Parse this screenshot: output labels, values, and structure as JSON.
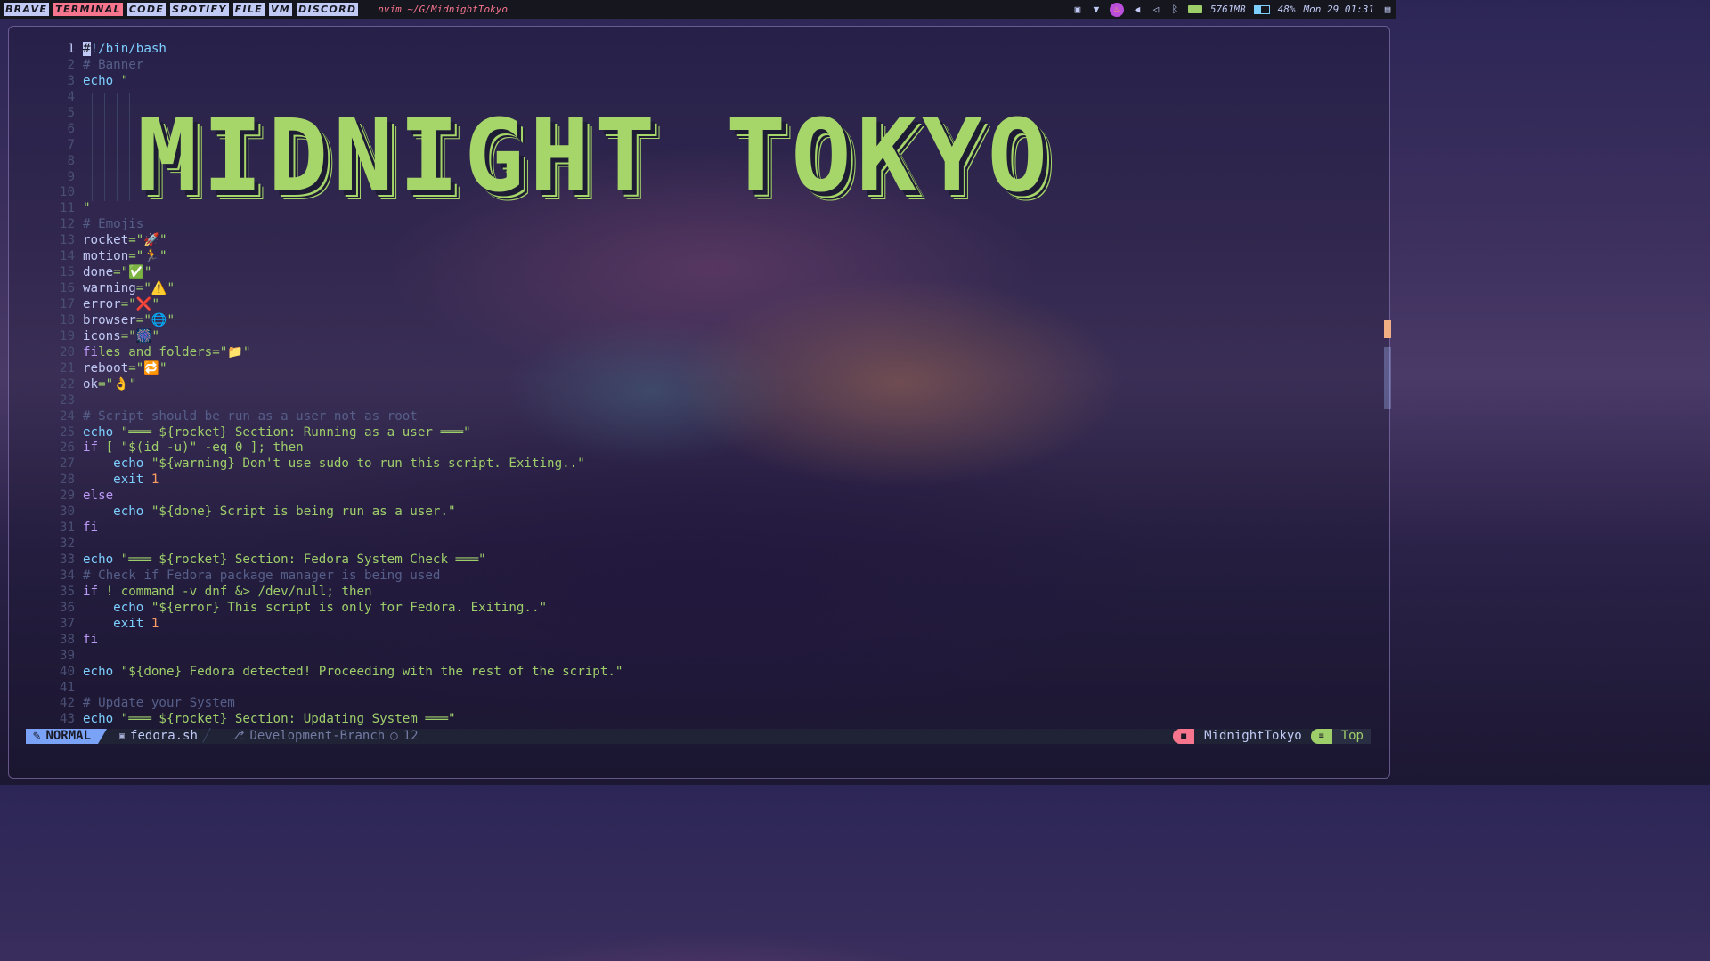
{
  "topbar": {
    "workspaces": [
      "BRAVE",
      "TERMINAL",
      "CODE",
      "SPOTIFY",
      "FILE",
      "VM",
      "DISCORD"
    ],
    "active_workspace": "TERMINAL",
    "window_title": "nvim ~/G/MidnightTokyo",
    "memory": "5761MB",
    "battery": "48%",
    "battery_level": 0.48,
    "clock": "Mon 29 01:31",
    "tray_icons": [
      "image-icon",
      "wifi-icon",
      "firefox-icon",
      "volume-icon",
      "speaker-icon",
      "bluetooth-icon",
      "memory-icon",
      "battery-icon",
      "layout-icon"
    ]
  },
  "editor": {
    "banner_text": "MIDNIGHT TOKYO",
    "lines": [
      {
        "n": "1",
        "t": "#!/bin/bash"
      },
      {
        "n": "2",
        "t": "# Banner"
      },
      {
        "n": "3",
        "t": "echo \""
      },
      {
        "n": "4",
        "t": ""
      },
      {
        "n": "5",
        "t": ""
      },
      {
        "n": "6",
        "t": ""
      },
      {
        "n": "7",
        "t": ""
      },
      {
        "n": "8",
        "t": ""
      },
      {
        "n": "9",
        "t": ""
      },
      {
        "n": "10",
        "t": ""
      },
      {
        "n": "11",
        "t": "\""
      },
      {
        "n": "12",
        "t": "# Emojis"
      },
      {
        "n": "13",
        "t": "rocket=\"🚀\""
      },
      {
        "n": "14",
        "t": "motion=\"🏃\""
      },
      {
        "n": "15",
        "t": "done=\"✅\""
      },
      {
        "n": "16",
        "t": "warning=\"⚠️\""
      },
      {
        "n": "17",
        "t": "error=\"❌\""
      },
      {
        "n": "18",
        "t": "browser=\"🌐\""
      },
      {
        "n": "19",
        "t": "icons=\"🎆\""
      },
      {
        "n": "20",
        "t": "files_and_folders=\"📁\""
      },
      {
        "n": "21",
        "t": "reboot=\"🔁\""
      },
      {
        "n": "22",
        "t": "ok=\"👌\""
      },
      {
        "n": "23",
        "t": ""
      },
      {
        "n": "24",
        "t": "# Script should be run as a user not as root"
      },
      {
        "n": "25",
        "t": "echo \"═══ ${rocket} Section: Running as a user ═══\""
      },
      {
        "n": "26",
        "t": "if [ \"$(id -u)\" -eq 0 ]; then"
      },
      {
        "n": "27",
        "t": "    echo \"${warning} Don't use sudo to run this script. Exiting..\""
      },
      {
        "n": "28",
        "t": "    exit 1"
      },
      {
        "n": "29",
        "t": "else"
      },
      {
        "n": "30",
        "t": "    echo \"${done} Script is being run as a user.\""
      },
      {
        "n": "31",
        "t": "fi"
      },
      {
        "n": "32",
        "t": ""
      },
      {
        "n": "33",
        "t": "echo \"═══ ${rocket} Section: Fedora System Check ═══\""
      },
      {
        "n": "34",
        "t": "# Check if Fedora package manager is being used"
      },
      {
        "n": "35",
        "t": "if ! command -v dnf &> /dev/null; then"
      },
      {
        "n": "36",
        "t": "    echo \"${error} This script is only for Fedora. Exiting..\""
      },
      {
        "n": "37",
        "t": "    exit 1"
      },
      {
        "n": "38",
        "t": "fi"
      },
      {
        "n": "39",
        "t": ""
      },
      {
        "n": "40",
        "t": "echo \"${done} Fedora detected! Proceeding with the rest of the script.\""
      },
      {
        "n": "41",
        "t": ""
      },
      {
        "n": "42",
        "t": "# Update your System"
      },
      {
        "n": "43",
        "t": "echo \"═══ ${rocket} Section: Updating System ═══\""
      }
    ]
  },
  "statusline": {
    "mode": "NORMAL",
    "file": "fedora.sh",
    "branch": "Development-Branch",
    "changes": "12",
    "project": "MidnightTokyo",
    "position": "Top"
  }
}
